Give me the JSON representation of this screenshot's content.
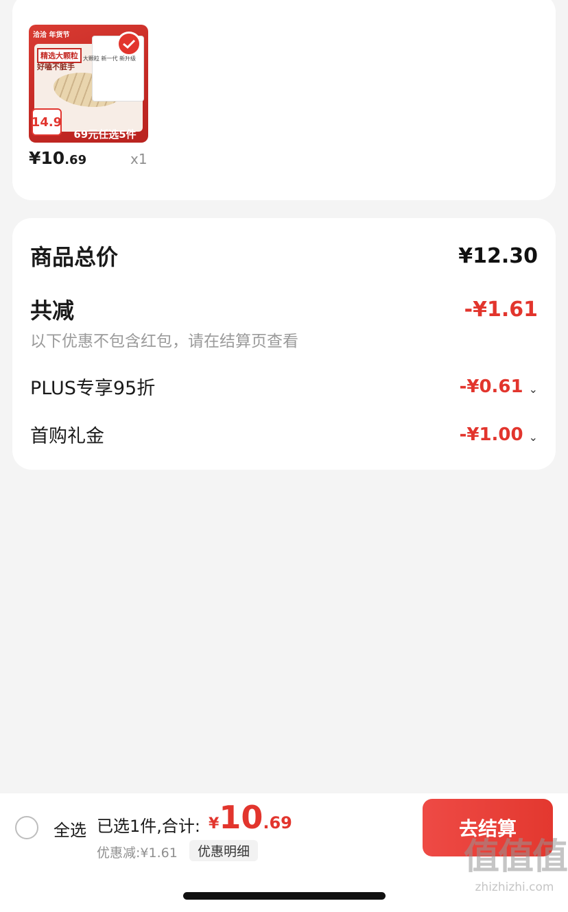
{
  "product": {
    "thumbnail": {
      "brand": "洽洽 年货节",
      "tag_primary": "精选大颗粒",
      "tag_secondary": "好嗑不脏手",
      "bag_text": "大颗粒 新一代 新升级",
      "price_badge": "14.9",
      "banner": "69元任选5件"
    },
    "price_symbol": "¥",
    "price_int": "10",
    "price_dec": ".69",
    "quantity": "x1"
  },
  "summary": {
    "total_label": "商品总价",
    "total_value": "¥12.30",
    "reduce_label": "共减",
    "reduce_value": "-¥1.61",
    "note": "以下优惠不包含红包，请在结算页查看",
    "discounts": [
      {
        "label": "PLUS专享95折",
        "value": "-¥0.61"
      },
      {
        "label": "首购礼金",
        "value": "-¥1.00"
      }
    ]
  },
  "bottom_bar": {
    "select_all": "全选",
    "selected_info": "已选1件,合计:",
    "total_symbol": "¥",
    "total_int": "10",
    "total_dec": ".69",
    "discount_text": "优惠减:¥1.61",
    "detail_button": "优惠明细",
    "checkout_button": "去结算"
  },
  "watermark": {
    "big": "值值值",
    "small": "zhizhizhi.com"
  },
  "colors": {
    "accent": "#e2352d",
    "checkout_start": "#ee4a45",
    "checkout_end": "#e3382f",
    "page_bg": "#f4f4f4"
  }
}
